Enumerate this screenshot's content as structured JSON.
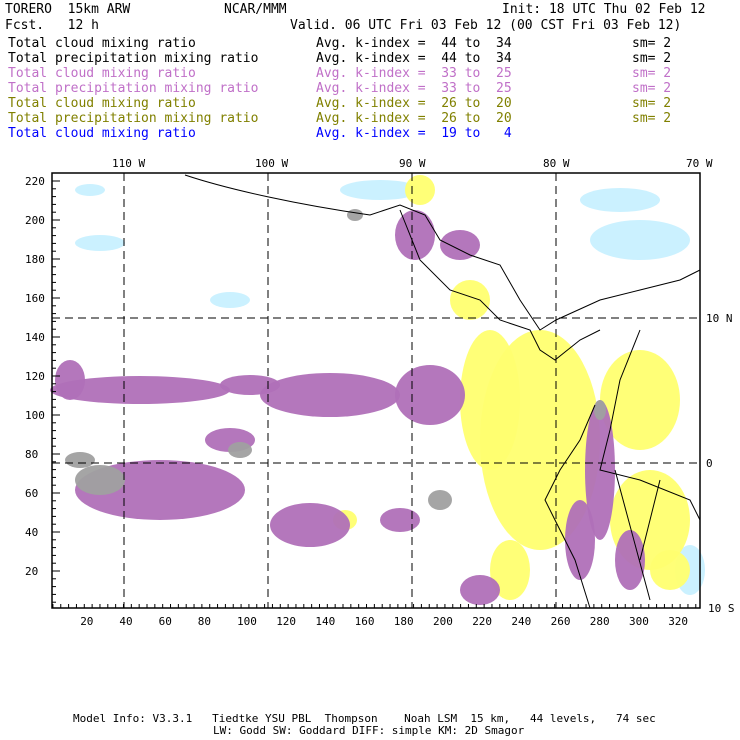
{
  "header": {
    "model": "TORERO  15km ARW",
    "org": "NCAR/MMM",
    "init": "Init: 18 UTC Thu 02 Feb 12",
    "fcst": "Fcst.   12 h",
    "valid": "Valid. 06 UTC Fri 03 Feb 12 (00 CST Fri 03 Feb 12)"
  },
  "legend": [
    {
      "field": "Total cloud mixing ratio",
      "range": "Avg. k-index =  44 to  34",
      "sm": "sm= 2",
      "color": "#000000"
    },
    {
      "field": "Total precipitation mixing ratio",
      "range": "Avg. k-index =  44 to  34",
      "sm": "sm= 2",
      "color": "#000000"
    },
    {
      "field": "Total cloud mixing ratio",
      "range": "Avg. k-index =  33 to  25",
      "sm": "sm= 2",
      "color": "#c070c8"
    },
    {
      "field": "Total precipitation mixing ratio",
      "range": "Avg. k-index =  33 to  25",
      "sm": "sm= 2",
      "color": "#c070c8"
    },
    {
      "field": "Total cloud mixing ratio",
      "range": "Avg. k-index =  26 to  20",
      "sm": "sm= 2",
      "color": "#808000"
    },
    {
      "field": "Total precipitation mixing ratio",
      "range": "Avg. k-index =  26 to  20",
      "sm": "sm= 2",
      "color": "#808000"
    },
    {
      "field": "Total cloud mixing ratio",
      "range": "Avg. k-index =  19 to   4",
      "sm": "",
      "color": "#0000ff"
    }
  ],
  "axes": {
    "lon_labels": [
      "110 W",
      "100 W",
      "90 W",
      "80 W",
      "70 W"
    ],
    "lat_labels": [
      "10 N",
      "0",
      "10 S"
    ],
    "x_ticks": [
      "20",
      "40",
      "60",
      "80",
      "100",
      "120",
      "140",
      "160",
      "180",
      "200",
      "220",
      "240",
      "260",
      "280",
      "300",
      "320"
    ],
    "y_ticks": [
      "20",
      "40",
      "60",
      "80",
      "100",
      "120",
      "140",
      "160",
      "180",
      "200",
      "220"
    ]
  },
  "footer": {
    "line1": "Model Info: V3.3.1   Tiedtke YSU PBL  Thompson    Noah LSM  15 km,   44 levels,   74 sec",
    "line2": "LW: Godd SW: Goddard DIFF: simple KM: 2D Smagor"
  },
  "colors": {
    "purple": "#b070b8",
    "yellow": "#ffff70",
    "gray": "#a0a0a0",
    "lightblue": "#c8f0ff"
  }
}
